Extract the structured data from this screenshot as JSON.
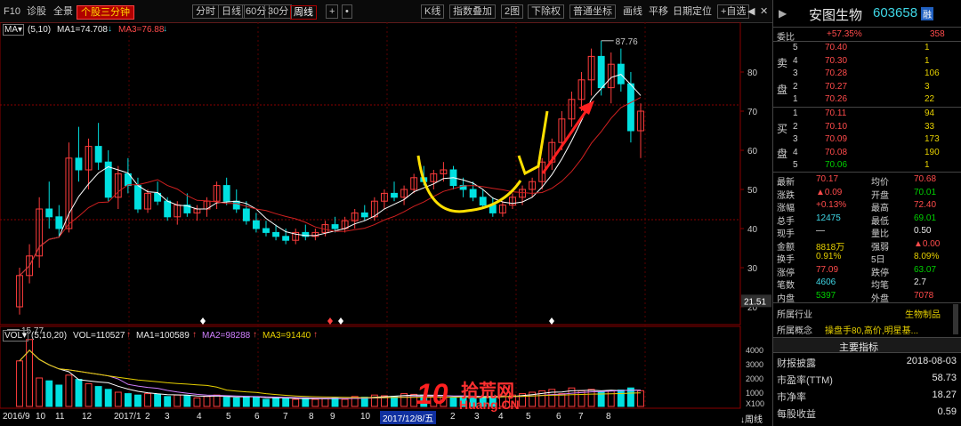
{
  "toolbar": {
    "f10": "F10",
    "diagnose": "诊股",
    "panorama": "全景",
    "triple_screen": "个股三分钟",
    "timeshare": "分时",
    "daily": "日线",
    "min60": "60分",
    "min30": "30分",
    "weekly": "周线",
    "plus": "+",
    "dots": "•",
    "kline_type": "K线",
    "index_overlay": "指数叠加",
    "two_charts": "2图",
    "ex_rights": "下除权",
    "coords": "普通坐标",
    "draw_line": "画线",
    "pan": "平移",
    "date_locate": "日期定位",
    "add_watch": "+自选",
    "nav_left": "◀",
    "nav_right": "▶",
    "close": "✕"
  },
  "indicators": {
    "ma_selector": "MA▾",
    "ma_params": "(5,10)",
    "ma1": "MA1=74.708",
    "ma3": "MA3=76.88",
    "down_arrow": "↓",
    "vol_selector": "VOL▾",
    "vol_params": "(5,10,20)",
    "vol": "VOL=110527",
    "vol_ma1": "MA1=100589",
    "vol_ma2": "MA2=98288",
    "vol_ma3": "MA3=91440",
    "up_arrow": "↑"
  },
  "chart_data": {
    "type": "candlestick",
    "high_label": "87.76",
    "low_label": "15.77",
    "price_ticks": [
      "80",
      "70",
      "60",
      "50",
      "40",
      "30",
      "20"
    ],
    "current_price_tag": "21.51",
    "volume_ticks": [
      "4000",
      "3000",
      "2000",
      "1000"
    ],
    "volume_unit": "X100",
    "x_labels": [
      "2016/9",
      "10",
      "11",
      "12",
      "2017/1",
      "2",
      "3",
      "4",
      "5",
      "6",
      "7",
      "8",
      "9",
      "10",
      "2017/12",
      "1",
      "2",
      "3",
      "4",
      "5",
      "6",
      "7",
      "8"
    ],
    "x_selected_label": "2017/12/8/五",
    "period_label": "↓周线",
    "candles": [
      [
        20,
        30,
        18,
        28
      ],
      [
        28,
        36,
        26,
        33
      ],
      [
        33,
        48,
        30,
        45
      ],
      [
        45,
        52,
        40,
        43
      ],
      [
        43,
        46,
        38,
        40
      ],
      [
        40,
        62,
        39,
        58
      ],
      [
        58,
        66,
        52,
        55
      ],
      [
        55,
        63,
        50,
        61
      ],
      [
        61,
        67,
        55,
        57
      ],
      [
        57,
        60,
        47,
        48
      ],
      [
        48,
        56,
        45,
        54
      ],
      [
        54,
        58,
        49,
        51
      ],
      [
        51,
        53,
        44,
        45
      ],
      [
        45,
        50,
        44,
        49
      ],
      [
        49,
        52,
        46,
        47
      ],
      [
        47,
        48,
        42,
        43
      ],
      [
        43,
        47,
        41,
        46
      ],
      [
        46,
        49,
        43,
        44
      ],
      [
        44,
        46,
        42,
        45
      ],
      [
        45,
        48,
        43,
        47
      ],
      [
        47,
        52,
        45,
        51
      ],
      [
        51,
        53,
        46,
        47
      ],
      [
        47,
        50,
        44,
        45
      ],
      [
        45,
        47,
        41,
        42
      ],
      [
        42,
        44,
        39,
        40
      ],
      [
        40,
        42,
        38,
        39
      ],
      [
        39,
        41,
        37,
        38
      ],
      [
        38,
        40,
        36,
        37
      ],
      [
        37,
        40,
        36,
        39
      ],
      [
        39,
        41,
        37,
        38
      ],
      [
        38,
        40,
        37,
        39
      ],
      [
        39,
        42,
        38,
        41
      ],
      [
        41,
        43,
        39,
        40
      ],
      [
        40,
        43,
        39,
        42
      ],
      [
        42,
        45,
        40,
        44
      ],
      [
        44,
        46,
        42,
        43
      ],
      [
        43,
        48,
        42,
        47
      ],
      [
        47,
        50,
        45,
        49
      ],
      [
        49,
        52,
        47,
        48
      ],
      [
        48,
        51,
        46,
        50
      ],
      [
        50,
        54,
        49,
        53
      ],
      [
        53,
        56,
        51,
        52
      ],
      [
        52,
        55,
        50,
        54
      ],
      [
        54,
        57,
        52,
        55
      ],
      [
        55,
        56,
        50,
        51
      ],
      [
        51,
        53,
        48,
        50
      ],
      [
        50,
        52,
        47,
        48
      ],
      [
        48,
        50,
        45,
        46
      ],
      [
        46,
        48,
        43,
        44
      ],
      [
        44,
        47,
        43,
        46
      ],
      [
        46,
        49,
        45,
        48
      ],
      [
        48,
        51,
        46,
        50
      ],
      [
        50,
        53,
        48,
        52
      ],
      [
        52,
        58,
        50,
        57
      ],
      [
        57,
        63,
        55,
        62
      ],
      [
        62,
        70,
        60,
        68
      ],
      [
        68,
        75,
        66,
        73
      ],
      [
        73,
        80,
        70,
        78
      ],
      [
        78,
        86,
        74,
        84
      ],
      [
        84,
        88,
        74,
        76
      ],
      [
        76,
        85,
        72,
        82
      ],
      [
        82,
        86,
        75,
        77
      ],
      [
        77,
        80,
        62,
        65
      ],
      [
        65,
        72,
        58,
        70
      ]
    ],
    "ma_fast_label": "MA1",
    "ma_slow_label": "MA3",
    "volumes": [
      3200,
      4700,
      2000,
      1800,
      1500,
      2200,
      1900,
      1600,
      1400,
      1200,
      1000,
      900,
      800,
      900,
      850,
      700,
      800,
      750,
      600,
      700,
      800,
      650,
      600,
      700,
      650,
      500,
      600,
      550,
      500,
      600,
      500,
      550,
      600,
      500,
      700,
      650,
      800,
      750,
      700,
      900,
      850,
      800,
      700,
      650,
      600,
      700,
      600,
      650,
      700,
      750,
      800,
      900,
      1000,
      1100,
      1200,
      900,
      1300,
      1100,
      1200,
      1000,
      1100,
      1150,
      1300,
      1105
    ]
  },
  "panel": {
    "stock_name": "安图生物",
    "stock_code": "603658",
    "badge": "融",
    "weibi_label": "委比",
    "weibi_value": "+57.35%",
    "weicha_value": "358",
    "sell_label_1": "卖",
    "sell_label_2": "盘",
    "buy_label_1": "买",
    "buy_label_2": "盘",
    "asks": [
      {
        "level": "5",
        "price": "70.40",
        "vol": "1"
      },
      {
        "level": "4",
        "price": "70.30",
        "vol": "1"
      },
      {
        "level": "3",
        "price": "70.28",
        "vol": "106"
      },
      {
        "level": "2",
        "price": "70.27",
        "vol": "3"
      },
      {
        "level": "1",
        "price": "70.26",
        "vol": "22"
      }
    ],
    "bids": [
      {
        "level": "1",
        "price": "70.11",
        "vol": "94"
      },
      {
        "level": "2",
        "price": "70.10",
        "vol": "33"
      },
      {
        "level": "3",
        "price": "70.09",
        "vol": "173"
      },
      {
        "level": "4",
        "price": "70.08",
        "vol": "190"
      },
      {
        "level": "5",
        "price": "70.06",
        "vol": "1"
      }
    ],
    "stats": [
      {
        "l1": "最新",
        "v1": "70.17",
        "c1": "red",
        "l2": "均价",
        "v2": "70.68",
        "c2": "red"
      },
      {
        "l1": "涨跌",
        "v1": "▲0.09",
        "c1": "red",
        "l2": "开盘",
        "v2": "70.01",
        "c2": "green"
      },
      {
        "l1": "涨幅",
        "v1": "+0.13%",
        "c1": "red",
        "l2": "最高",
        "v2": "72.40",
        "c2": "red"
      },
      {
        "l1": "总手",
        "v1": "12475",
        "c1": "cyan",
        "l2": "最低",
        "v2": "69.01",
        "c2": "green"
      },
      {
        "l1": "现手",
        "v1": "—",
        "c1": "white",
        "l2": "量比",
        "v2": "0.50",
        "c2": "white"
      },
      {
        "l1": "金额",
        "v1": "8818万",
        "c1": "yellow",
        "l2": "强弱",
        "v2": "▲0.00",
        "c2": "red"
      },
      {
        "l1": "换手",
        "v1": "0.91%",
        "c1": "yellow",
        "l2": "5日",
        "v2": "8.09%",
        "c2": "yellow"
      },
      {
        "l1": "涨停",
        "v1": "77.09",
        "c1": "red",
        "l2": "跌停",
        "v2": "63.07",
        "c2": "green"
      },
      {
        "l1": "笔数",
        "v1": "4606",
        "c1": "cyan",
        "l2": "均笔",
        "v2": "2.7",
        "c2": "white"
      },
      {
        "l1": "内盘",
        "v1": "5397",
        "c1": "green",
        "l2": "外盘",
        "v2": "7078",
        "c2": "red"
      }
    ],
    "industry_label": "所属行业",
    "industry_value": "生物制品",
    "concept_label": "所属概念",
    "concept_value": "操盘手80,高价,明星基...",
    "main_indicators_title": "主要指标",
    "metrics": [
      {
        "label": "财报披露",
        "value": "2018-08-03"
      },
      {
        "label": "市盈率(TTM)",
        "value": "58.73"
      },
      {
        "label": "市净率",
        "value": "18.27"
      },
      {
        "label": "每股收益",
        "value": "0.59"
      }
    ]
  },
  "watermark": {
    "text_cn": "拾荒网",
    "text_en": "Huang.CN",
    "number": "10"
  }
}
